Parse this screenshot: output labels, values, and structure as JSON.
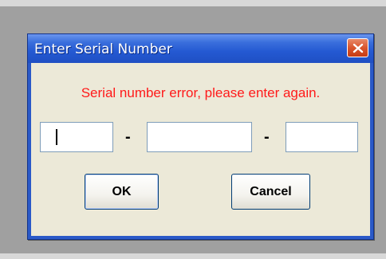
{
  "dialog": {
    "title": "Enter Serial Number",
    "error_message": "Serial number error, please enter again.",
    "separator": "-",
    "fields": [
      {
        "value": ""
      },
      {
        "value": ""
      },
      {
        "value": ""
      }
    ],
    "ok_label": "OK",
    "cancel_label": "Cancel",
    "close_icon": "close-icon"
  },
  "colors": {
    "title_bar": "#2459d2",
    "close_button": "#d9552d",
    "error_text": "#ff1a1a",
    "client_background": "#ece9d8"
  }
}
